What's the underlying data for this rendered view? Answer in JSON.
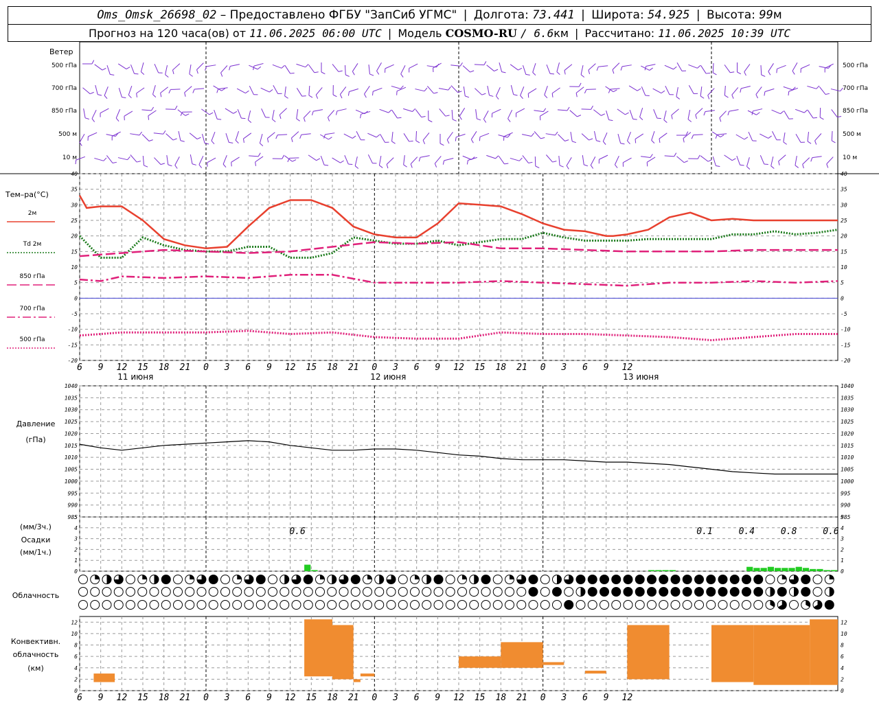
{
  "header": {
    "station": "Oms_Omsk_26698_02",
    "dash": "–",
    "provider": "Предоставлено ФГБУ \"ЗапСиб УГМС\"",
    "lon_label": "Долгота:",
    "lon_value": "73.441",
    "lat_label": "Широта:",
    "lat_value": "54.925",
    "alt_label": "Высота:",
    "alt_value": "99",
    "alt_unit": "м",
    "forecast_label": "Прогноз на 120 часа(ов) от",
    "forecast_time": "11.06.2025 06:00 UTC",
    "model_label": "Модель",
    "model_name": "COSMO-RU",
    "model_res": "/ 6.6",
    "model_res_unit": "км",
    "calc_label": "Рассчитано:",
    "calc_time": "11.06.2025 10:39 UTC",
    "sep": "|"
  },
  "wind_panel": {
    "title": "Ветер",
    "levels": [
      "500 гПа",
      "700 гПа",
      "850 гПа",
      "500 м",
      "10  м"
    ],
    "color": "#7a2fd0"
  },
  "temp_panel": {
    "title": "Тем–ра(°С)",
    "legend": [
      {
        "label": "2м",
        "color": "#e8402e",
        "style": "solid"
      },
      {
        "label": "Td  2м",
        "color": "#1a7a1a",
        "style": "dotted"
      },
      {
        "label": "850 гПа",
        "color": "#e0207a",
        "style": "dashed"
      },
      {
        "label": "700 гПа",
        "color": "#e0207a",
        "style": "dashdot"
      },
      {
        "label": "500 гПа",
        "color": "#e0207a",
        "style": "dotted"
      }
    ],
    "yticks": [
      "40",
      "35",
      "30",
      "25",
      "20",
      "15",
      "10",
      "5",
      "0",
      "-5",
      "-10",
      "-15",
      "-20"
    ]
  },
  "x_axis": {
    "hours": [
      "6",
      "9",
      "12",
      "15",
      "18",
      "21",
      "0",
      "3",
      "6",
      "9",
      "12",
      "15",
      "18",
      "21",
      "0",
      "3",
      "6",
      "9",
      "12",
      "15",
      "18",
      "21",
      "0",
      "3",
      "6",
      "9",
      "12"
    ],
    "days": [
      "11 июня",
      "12 июня",
      "13 июня"
    ]
  },
  "pressure_panel": {
    "title": "Давление",
    "unit": "(гПа)",
    "yticks": [
      "1040",
      "1035",
      "1030",
      "1025",
      "1020",
      "1015",
      "1010",
      "1005",
      "1000",
      "995",
      "990",
      "985"
    ]
  },
  "precip_panel": {
    "unit3": "(мм/3ч.)",
    "title": "Осадки",
    "unit1": "(мм/1ч.)",
    "yticks": [
      "5",
      "4",
      "3",
      "2",
      "1",
      "0"
    ],
    "totals": [
      {
        "label": "0.6",
        "hour": 32
      },
      {
        "label": "0.1",
        "hour": 90
      },
      {
        "label": "0.4",
        "hour": 96
      },
      {
        "label": "0.8",
        "hour": 102
      },
      {
        "label": "0.6",
        "hour": 108
      }
    ],
    "color": "#22cc22"
  },
  "cloud_panel": {
    "title": "Облачность"
  },
  "conv_panel": {
    "title_line1": "Конвективн.",
    "title_line2": "облачность",
    "unit": "(км)",
    "yticks": [
      "12",
      "10",
      "8",
      "6",
      "4",
      "2",
      "0"
    ],
    "color": "#f08c30"
  },
  "chart_data": [
    {
      "type": "line",
      "title": "Тем–ра(°С)",
      "x_unit": "hours from 11.06.2025 06:00 UTC",
      "ylim": [
        -20,
        40
      ],
      "grid": true,
      "series": [
        {
          "name": "2м",
          "x": [
            0,
            1,
            3,
            6,
            9,
            12,
            15,
            18,
            21,
            24,
            27,
            30,
            33,
            36,
            39,
            42,
            45,
            48,
            51,
            54,
            57,
            60,
            63,
            66,
            69,
            72,
            75,
            76,
            78,
            81,
            84,
            87,
            90,
            93,
            96,
            99,
            102,
            105,
            107,
            108
          ],
          "values": [
            33,
            29,
            29.5,
            29.5,
            25,
            19,
            17,
            16,
            16.5,
            23,
            29,
            31.5,
            31.5,
            29,
            23,
            20.5,
            19.5,
            19.5,
            24,
            30.5,
            30,
            29.5,
            27,
            24,
            22,
            21.5,
            20,
            20,
            20.5,
            22,
            26,
            27.5,
            25,
            25.5,
            25,
            25,
            25,
            25,
            25,
            25
          ]
        },
        {
          "name": "Td  2м",
          "x": [
            0,
            3,
            6,
            9,
            12,
            15,
            18,
            21,
            24,
            27,
            30,
            33,
            36,
            39,
            42,
            45,
            48,
            51,
            54,
            57,
            60,
            63,
            66,
            69,
            72,
            75,
            78,
            81,
            84,
            87,
            90,
            93,
            96,
            99,
            102,
            105,
            108
          ],
          "values": [
            20,
            13,
            13,
            19.5,
            17,
            15.5,
            15,
            15,
            16.5,
            16.5,
            13,
            13,
            14.5,
            19.5,
            18.5,
            17.5,
            17.5,
            18.5,
            17,
            18,
            19,
            19,
            21,
            19.5,
            18.5,
            18.5,
            18.5,
            19,
            19,
            19,
            19,
            20.5,
            20.5,
            21.5,
            20.5,
            21,
            22
          ]
        },
        {
          "name": "850 гПа",
          "x": [
            0,
            6,
            12,
            18,
            24,
            30,
            36,
            42,
            48,
            54,
            60,
            66,
            72,
            78,
            84,
            90,
            96,
            102,
            108
          ],
          "values": [
            13.5,
            14.5,
            15.5,
            15,
            14.5,
            15,
            16.5,
            18,
            17.5,
            18,
            16,
            16,
            15.5,
            15,
            15,
            15,
            15.5,
            15.5,
            15.5
          ]
        },
        {
          "name": "700 гПа",
          "x": [
            0,
            3,
            6,
            12,
            18,
            24,
            30,
            36,
            42,
            48,
            54,
            60,
            66,
            72,
            78,
            84,
            90,
            96,
            102,
            108
          ],
          "values": [
            6,
            5.5,
            7,
            6.5,
            7,
            6.5,
            7.5,
            7.5,
            5,
            5,
            5,
            5.5,
            5,
            4.5,
            4,
            5,
            5,
            5.5,
            5,
            5.5
          ]
        },
        {
          "name": "500 гПа",
          "x": [
            0,
            3,
            6,
            12,
            18,
            24,
            30,
            36,
            42,
            48,
            54,
            60,
            66,
            72,
            78,
            84,
            90,
            96,
            102,
            108
          ],
          "values": [
            -12,
            -11.5,
            -11,
            -11,
            -11,
            -10.5,
            -11.5,
            -11,
            -12.5,
            -13,
            -13,
            -11,
            -11.5,
            -11.5,
            -12,
            -12.5,
            -13.5,
            -12.5,
            -11.5,
            -11.5
          ]
        }
      ]
    },
    {
      "type": "line",
      "title": "Давление",
      "ylabel": "(гПа)",
      "ylim": [
        985,
        1040
      ],
      "grid": true,
      "series": [
        {
          "name": "Давление",
          "x": [
            0,
            3,
            6,
            9,
            12,
            15,
            18,
            21,
            24,
            27,
            30,
            33,
            36,
            39,
            42,
            45,
            48,
            51,
            54,
            57,
            60,
            63,
            66,
            69,
            72,
            75,
            78,
            81,
            84,
            87,
            90,
            93,
            96,
            99,
            102,
            105,
            108
          ],
          "values": [
            1015.5,
            1014,
            1013,
            1014,
            1015,
            1015.5,
            1016,
            1016.5,
            1017,
            1016.5,
            1015,
            1014,
            1013,
            1013,
            1013.5,
            1013.5,
            1013,
            1012,
            1011,
            1010.5,
            1009.5,
            1009,
            1009,
            1009,
            1008.5,
            1008,
            1008,
            1007.5,
            1007,
            1006,
            1005,
            1004,
            1003.5,
            1003,
            1003,
            1003,
            1003
          ]
        }
      ]
    },
    {
      "type": "bar",
      "title": "Осадки",
      "ylabel": "(мм/1ч.)",
      "ylim": [
        0,
        5
      ],
      "grid": true,
      "x_hours": [
        32,
        33,
        81,
        82,
        83,
        84,
        95,
        96,
        97,
        98,
        99,
        100,
        101,
        102,
        103,
        104,
        105,
        106,
        107
      ],
      "values": [
        0.6,
        0.1,
        0.1,
        0.1,
        0.1,
        0.1,
        0.4,
        0.3,
        0.3,
        0.4,
        0.3,
        0.3,
        0.3,
        0.4,
        0.3,
        0.2,
        0.2,
        0.1,
        0.1
      ]
    },
    {
      "type": "bar",
      "title": "Конвективн. облачность",
      "ylabel": "(км)",
      "ylim": [
        0,
        13
      ],
      "grid": true,
      "ranges": [
        {
          "from": 2,
          "to": 5,
          "bottom": 1.5,
          "top": 3
        },
        {
          "from": 40,
          "to": 42,
          "bottom": 2.5,
          "top": 3
        },
        {
          "from": 32,
          "to": 36,
          "bottom": 2.5,
          "top": 12.5
        },
        {
          "from": 36,
          "to": 39,
          "bottom": 2,
          "top": 11.5
        },
        {
          "from": 39,
          "to": 40,
          "bottom": 1.5,
          "top": 2
        },
        {
          "from": 54,
          "to": 60,
          "bottom": 4,
          "top": 6
        },
        {
          "from": 60,
          "to": 66,
          "bottom": 4,
          "top": 8.5
        },
        {
          "from": 66,
          "to": 69,
          "bottom": 4.5,
          "top": 5
        },
        {
          "from": 72,
          "to": 75,
          "bottom": 3,
          "top": 3.5
        },
        {
          "from": 78,
          "to": 84,
          "bottom": 2,
          "top": 11.5
        },
        {
          "from": 90,
          "to": 96,
          "bottom": 1.5,
          "top": 11.5
        },
        {
          "from": 96,
          "to": 104,
          "bottom": 1,
          "top": 11.5
        },
        {
          "from": 104,
          "to": 108,
          "bottom": 1,
          "top": 12.5
        }
      ]
    }
  ]
}
